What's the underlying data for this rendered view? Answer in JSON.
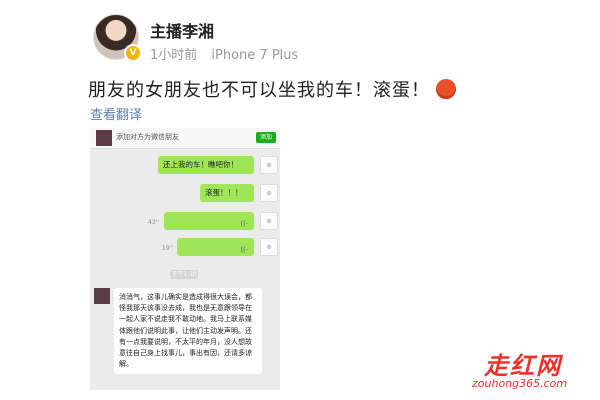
{
  "post": {
    "username": "主播李湘",
    "time": "1小时前",
    "device": "iPhone 7 Plus",
    "text": "朋友的女朋友也不可以坐我的车！滚蛋！",
    "emoji": "angry-face-emoji",
    "translate": "查看翻译",
    "verified_badge": "V"
  },
  "chat": {
    "notice": "添加对方为微信朋友",
    "add_button": "添加",
    "messages": [
      {
        "text": "还上我的车！瞧吧你！"
      },
      {
        "text": "滚蛋！！！"
      },
      {
        "duration": "43''"
      },
      {
        "duration": "19''"
      }
    ],
    "timestamp": "下午1:10",
    "reply": "消消气，这事儿确实是造成得很大误会，都怪我那天该事没去成，我也是无意跟领导在一起人家不说走我不敢动地。我马上联系媒体跟他们说明此事，让他们主动发声明。还有一点我要说明，不太平的年月，没人想故意往自己身上找事儿，事出有因，还请多谅解。"
  },
  "watermark": {
    "logo": "走红网",
    "site": "zouhong365.com"
  },
  "colors": {
    "bubble": "#9fe658",
    "link": "#5b7fae",
    "watermark": "#e8322a"
  }
}
